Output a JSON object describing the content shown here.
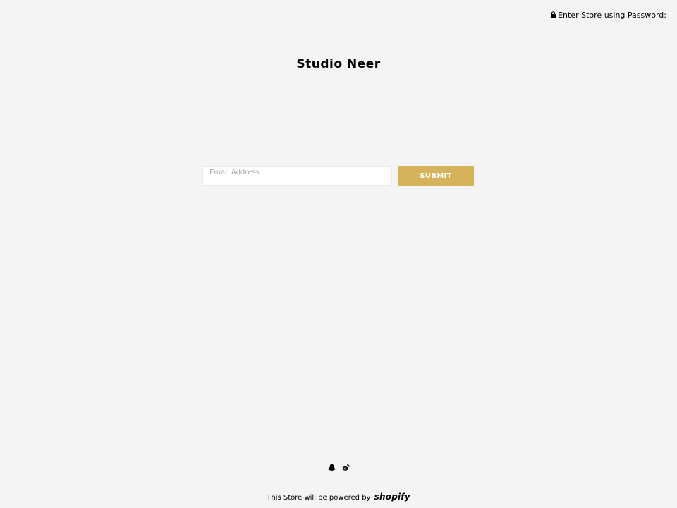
{
  "header": {
    "password_link_label": "Enter Store using Password:",
    "lock_icon": "lock-icon"
  },
  "store": {
    "title": "Studio Neer"
  },
  "signup": {
    "email_placeholder": "Email Address",
    "email_value": "",
    "submit_label": "SUBMIT",
    "submit_color": "#d5b35a"
  },
  "social": {
    "icons": [
      "snapchat-icon",
      "weibo-icon"
    ]
  },
  "footer": {
    "powered_text": "This Store will be powered by",
    "brand": "shopify"
  },
  "colors": {
    "background": "#f4f4f4",
    "accent": "#d5b35a"
  }
}
